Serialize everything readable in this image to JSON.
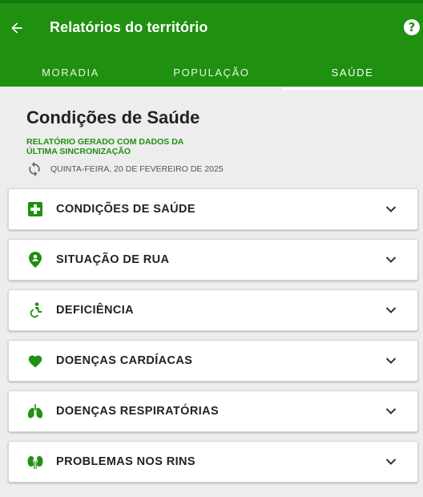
{
  "app_bar": {
    "title": "Relatórios do território",
    "back_icon": "arrow-left-icon",
    "help_icon": "help-circle-icon",
    "help_glyph": "?",
    "color": "#1f9010"
  },
  "tabs": [
    {
      "label": "MORADIA",
      "active": false
    },
    {
      "label": "POPULAÇÃO",
      "active": false
    },
    {
      "label": "SAÚDE",
      "active": true
    }
  ],
  "report": {
    "heading": "Condições de Saúde",
    "subtitle": "RELATÓRIO GERADO COM DADOS DA ÚLTIMA SINCRONIZAÇÃO",
    "sync_icon": "sync-icon",
    "date": "QUINTA-FEIRA, 20 DE FEVEREIRO DE 2025"
  },
  "sections": [
    {
      "label": "CONDIÇÕES DE SAÚDE",
      "icon": "medical-cross-icon"
    },
    {
      "label": "SITUAÇÃO DE RUA",
      "icon": "location-person-icon"
    },
    {
      "label": "DEFICIÊNCIA",
      "icon": "accessibility-icon"
    },
    {
      "label": "DOENÇAS CARDÍACAS",
      "icon": "heart-icon"
    },
    {
      "label": "DOENÇAS RESPIRATÓRIAS",
      "icon": "lungs-icon"
    },
    {
      "label": "PROBLEMAS NOS RINS",
      "icon": "kidneys-icon"
    }
  ],
  "accent_color": "#1f9010"
}
